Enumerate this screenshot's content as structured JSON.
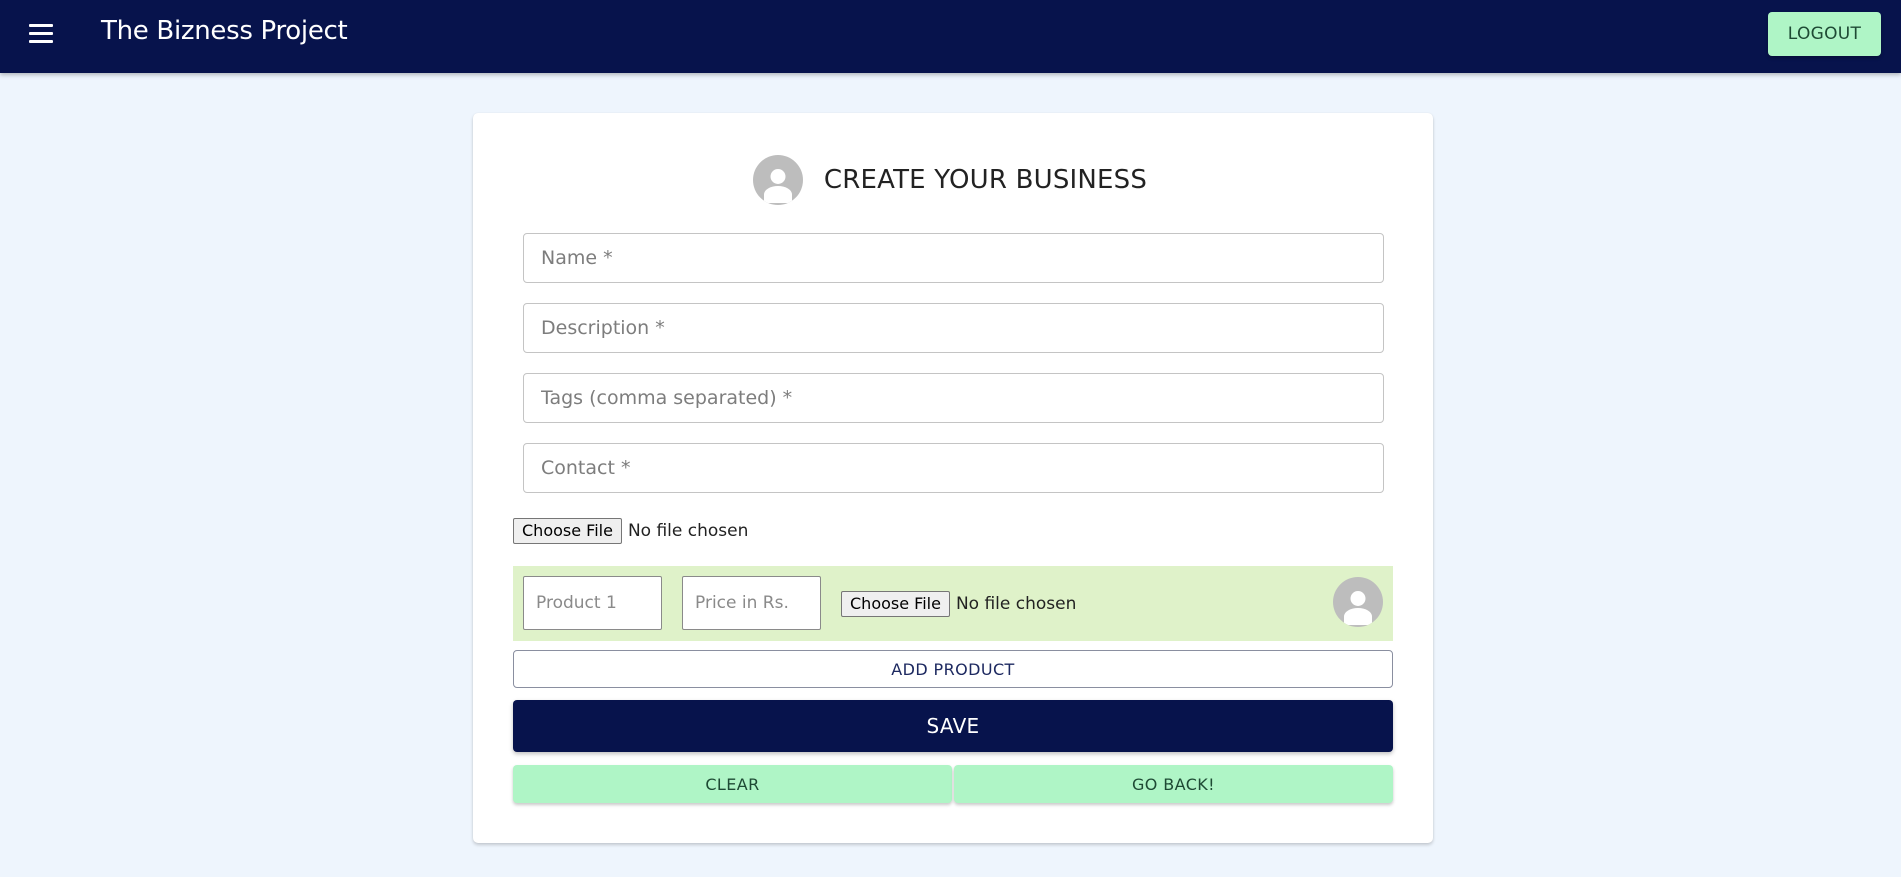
{
  "appbar": {
    "title": "The Bizness Project",
    "menu_icon": "hamburger-menu-icon",
    "logout_label": "LOGOUT"
  },
  "form": {
    "title": "CREATE YOUR BUSINESS",
    "avatar_icon": "user-avatar-icon",
    "fields": {
      "name_placeholder": "Name *",
      "description_placeholder": "Description *",
      "tags_placeholder": "Tags (comma separated) *",
      "contact_placeholder": "Contact *"
    },
    "file": {
      "button_label": "Choose File",
      "status": "No file chosen"
    },
    "product": {
      "name_placeholder": "Product 1",
      "price_placeholder": "Price in Rs.",
      "file_button_label": "Choose File",
      "file_status": "No file chosen",
      "avatar_icon": "user-avatar-icon"
    },
    "add_product_label": "ADD PRODUCT",
    "save_label": "SAVE",
    "clear_label": "CLEAR",
    "go_back_label": "GO BACK!"
  },
  "colors": {
    "appbar": "#07134c",
    "accent_green": "#aff5c6",
    "product_row": "#dff2c9",
    "page_background": "#eef5fd"
  }
}
